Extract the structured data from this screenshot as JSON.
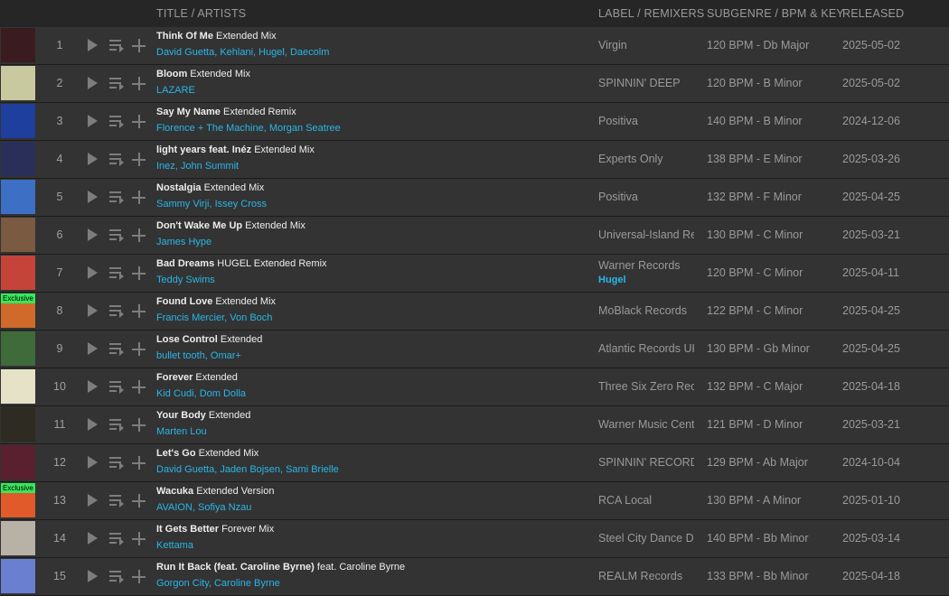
{
  "header": {
    "title_col": "TITLE / ARTISTS",
    "label_col": "LABEL / REMIXERS",
    "genre_col": "SUBGENRE / BPM & KEY",
    "released_col": "RELEASED"
  },
  "tracks": [
    {
      "num": "1",
      "title": "Think Of Me",
      "mix": "Extended Mix",
      "artists": "David Guetta, Kehlani, Hugel, Daecolm",
      "label": "Virgin",
      "remixer": "",
      "bpm_key": "120 BPM - Db Major",
      "released": "2025-05-02",
      "badge": "",
      "art_color": "#3a1b20"
    },
    {
      "num": "2",
      "title": "Bloom",
      "mix": "Extended Mix",
      "artists": "LAZARE",
      "label": "SPINNIN' DEEP",
      "remixer": "",
      "bpm_key": "120 BPM - B Minor",
      "released": "2025-05-02",
      "badge": "",
      "art_color": "#c9c9a0"
    },
    {
      "num": "3",
      "title": "Say My Name",
      "mix": "Extended Remix",
      "artists": "Florence + The Machine, Morgan Seatree",
      "label": "Positiva",
      "remixer": "",
      "bpm_key": "140 BPM - B Minor",
      "released": "2024-12-06",
      "badge": "",
      "art_color": "#1f3f9e"
    },
    {
      "num": "4",
      "title": "light years feat. Inéz",
      "mix": "Extended Mix",
      "artists": "Inez, John Summit",
      "label": "Experts Only",
      "remixer": "",
      "bpm_key": "138 BPM - E Minor",
      "released": "2025-03-26",
      "badge": "",
      "art_color": "#2a2f5a"
    },
    {
      "num": "5",
      "title": "Nostalgia",
      "mix": "Extended Mix",
      "artists": "Sammy Virji, Issey Cross",
      "label": "Positiva",
      "remixer": "",
      "bpm_key": "132 BPM - F Minor",
      "released": "2025-04-25",
      "badge": "",
      "art_color": "#3d6fc4"
    },
    {
      "num": "6",
      "title": "Don't Wake Me Up",
      "mix": "Extended Mix",
      "artists": "James Hype",
      "label": "Universal-Island Records",
      "remixer": "",
      "bpm_key": "130 BPM - C Minor",
      "released": "2025-03-21",
      "badge": "",
      "art_color": "#7a5a40"
    },
    {
      "num": "7",
      "title": "Bad Dreams",
      "mix": "HUGEL Extended Remix",
      "artists": "Teddy Swims",
      "label": "Warner Records",
      "remixer": "Hugel",
      "bpm_key": "120 BPM - C Minor",
      "released": "2025-04-11",
      "badge": "",
      "art_color": "#c4443a"
    },
    {
      "num": "8",
      "title": "Found Love",
      "mix": "Extended Mix",
      "artists": "Francis Mercier, Von Boch",
      "label": "MoBlack Records",
      "remixer": "",
      "bpm_key": "122 BPM - C Minor",
      "released": "2025-04-25",
      "badge": "Exclusive",
      "art_color": "#d06a2a"
    },
    {
      "num": "9",
      "title": "Lose Control",
      "mix": "Extended",
      "artists": "bullet tooth, Omar+",
      "label": "Atlantic Records UK",
      "remixer": "",
      "bpm_key": "130 BPM - Gb Minor",
      "released": "2025-04-25",
      "badge": "",
      "art_color": "#3f6a3a"
    },
    {
      "num": "10",
      "title": "Forever",
      "mix": "Extended",
      "artists": "Kid Cudi, Dom Dolla",
      "label": "Three Six Zero Recordings",
      "remixer": "",
      "bpm_key": "132 BPM - C Major",
      "released": "2025-04-18",
      "badge": "",
      "art_color": "#e6e2c8"
    },
    {
      "num": "11",
      "title": "Your Body",
      "mix": "Extended",
      "artists": "Marten Lou",
      "label": "Warner Music Central Europe",
      "remixer": "",
      "bpm_key": "121 BPM - D Minor",
      "released": "2025-03-21",
      "badge": "",
      "art_color": "#2d2b22"
    },
    {
      "num": "12",
      "title": "Let's Go",
      "mix": "Extended Mix",
      "artists": "David Guetta, Jaden Bojsen, Sami Brielle",
      "label": "SPINNIN' RECORDS",
      "remixer": "",
      "bpm_key": "129 BPM - Ab Major",
      "released": "2024-10-04",
      "badge": "",
      "art_color": "#5a2030"
    },
    {
      "num": "13",
      "title": "Wacuka",
      "mix": "Extended Version",
      "artists": "AVAION, Sofiya Nzau",
      "label": "RCA Local",
      "remixer": "",
      "bpm_key": "130 BPM - A Minor",
      "released": "2025-01-10",
      "badge": "Exclusive",
      "art_color": "#e05a2a"
    },
    {
      "num": "14",
      "title": "It Gets Better",
      "mix": "Forever Mix",
      "artists": "Kettama",
      "label": "Steel City Dance Discs",
      "remixer": "",
      "bpm_key": "140 BPM - Bb Minor",
      "released": "2025-03-14",
      "badge": "",
      "art_color": "#b8b2a6"
    },
    {
      "num": "15",
      "title": "Run It Back (feat. Caroline Byrne)",
      "mix": "feat. Caroline Byrne",
      "artists": "Gorgon City, Caroline Byrne",
      "label": "REALM Records",
      "remixer": "",
      "bpm_key": "133 BPM - Bb Minor",
      "released": "2025-04-18",
      "badge": "",
      "art_color": "#6a7fd0"
    }
  ]
}
